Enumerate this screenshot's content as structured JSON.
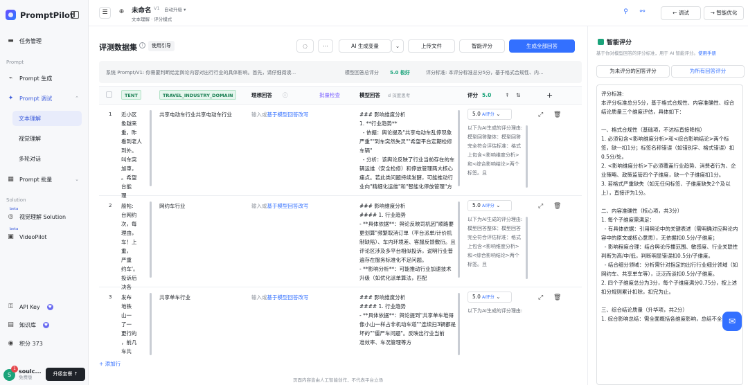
{
  "brand": {
    "name": "PromptPilot"
  },
  "sidebar": {
    "task_mgmt": "任务管理",
    "section_prompt": "Prompt",
    "prompt_gen": "Prompt 生成",
    "prompt_tune": "Prompt 调试",
    "sub_text": "文本理解",
    "sub_vision": "视觉理解",
    "sub_multi": "多轮对话",
    "prompt_batch": "Prompt 批量",
    "section_solution": "Solution",
    "beta1": "beta",
    "vision_solution": "视觉理解 Solution",
    "beta2": "beta",
    "videopilot": "VideoPilot",
    "api_key": "API Key",
    "knowledge": "知识库",
    "points": "积分 373",
    "user_initial": "S",
    "user_notif": "1",
    "user_name": "soulc...",
    "user_plan": "免费版",
    "upgrade": "升级套餐 ↑"
  },
  "topbar": {
    "title": "未命名",
    "version": "V1",
    "auto_upgrade": "自动升级 ▾",
    "breadcrumb": "文本理解 · 评分模式",
    "debug": "← 调试",
    "optimize": "→ 智能优化"
  },
  "dataset": {
    "title": "评测数据集",
    "guide": "使用引导",
    "ai_gen_var": "AI 生成变量",
    "upload": "上传文件",
    "smart_score": "智能评分",
    "gen_all": "生成全部回答"
  },
  "infobar": {
    "system_prompt": "系统 Prompt/V1: 你需要判断给定舆论内容对出行行业的具体影响。首先，请仔细阅读...",
    "avg_label": "模型回答总评分",
    "avg_value": "5.0 极好",
    "criteria": "评分标准: 本评分标准总分5分，基于格式合规性、内..."
  },
  "table": {
    "headers": {
      "content": "TENT",
      "domain": "TRAVEL_INDUSTRY_DOMAIN",
      "ideal": "理想回答",
      "batch_check": "批量检查",
      "model": "模型回答",
      "model_extra": "d  深度思考",
      "score": "评分",
      "score_val": "5.0"
    },
    "rows": [
      {
        "num": "1",
        "content": "近小区\n象越来\n重，昨\n看到老人\n到外。\n叫车突\n加車，\n。希望\n台能\n理",
        "domain": "共享电动车行业共享电动车行业",
        "ideal_ph": "输入或",
        "ideal_link": "基于模型回答改写",
        "model": "### 影响维度分析\n1. **行业趋势**\n  - 依据：舆论提及\"共享电动车乱停现象严重\"\"到车突然失灵\"\"希望平台定期检修车辆\"\n  - 分析：该舆论反映了行业当前存在的车辆运维（安全检修）和停放管理两大核心痛点。若此类问题持续发酵，可能推动行业向\"精细化运维\"和\"智能化停放管理\"方向升级（如强化",
        "score": "5.0",
        "ai": "AI评分",
        "reason": "以下为AI生成的评分理由:\n模型回答整体：模型回答完全符合评估标准：格式上包含<影响维度分析>和<综合影响结论>两个标签。且"
      },
      {
        "num": "2",
        "content": "般帖:\n台网约\n次，每\n理由，\n车！上\n重，\n严重\n约车'。\n投诉后\n决各",
        "domain": "网约车行业",
        "ideal_ph": "输入或",
        "ideal_link": "基于模型回答改写",
        "model": "### 影响维度分析\n#### 1. 行业趋势\n- **具体依据**：舆论反映司机因\"顺路要更划算\"频繁取消订单（平台派单/计价机制缺陷）、车内环境差、客服反馈敷衍。且评论区涉及多平台相似投诉，说明行业普遍存在服务标准化不足问题。\n- **影响分析**：可能推动行业加速技术升级（如优化派单算法，匹配",
        "score": "5.0",
        "ai": "AI评分",
        "reason": "以下为AI生成的评分理由:\n模型回答整体：模型回答完全符合评估标准：格式上包含<影响维度分析>和<综合影响结论>两个标签。且"
      },
      {
        "num": "3",
        "content": "发布\n地铁\n山一\n了一\n更行的\n，前几\n车共",
        "domain": "共享单车行业",
        "ideal_ph": "输入或",
        "ideal_link": "基于模型回答改写",
        "model": "### 影响维度分析\n#### 1. 行业趋势\n- **具体依据**：舆论提到\"共享单车堆得像小山一样占非机动车道\"\"连续扫3辆都是坏的\"\"僵尸车问题\"。反映出行业当前\n准效率、车况管理等方",
        "score": "5.0",
        "ai": "AI评分",
        "reason": "以下为AI生成的评分理由:"
      }
    ]
  },
  "add_row": "+ 添加行",
  "footer": "页面内容皆由人工智能创作，不代表平台立场",
  "panel": {
    "title": "智能评分",
    "desc": "基于你对模型回答的评分标准，用于 AI 智能评分。",
    "manual": "使用手册",
    "btn_unscored": "为未评分的回答评分",
    "btn_all": "为所有回答评分",
    "criteria": "评分标准:\n本评分标准总分5分，基于格式合规性、内容准确性、综合结论质量三个维度评估，具体如下：\n\n一、格式合规性（基础项，不达标直接降档）\n1. 必须包含<影响维度分析>和<综合影响结论>两个标签，缺一扣1分；标签名称错误（如错别字、格式错误）扣0.5分/处。\n2. <影响维度分析>下必须覆盖行业趋势、消费者行为、企业策略、政策监管四个子维度，缺一个子维度扣1分。\n3. 若格式严重缺失（如无任何标签、子维度缺失2个及以上），直接评为1分。\n\n二、内容准确性（核心项，共3分）\n1. 每个子维度需满足：\n  - 有具体依据：引用舆论中的关键表述（需明确对应舆论内容中的原文或核心意思），无依据扣0.5分/子维度；\n  - 影响程度合理：结合舆论传播范围、敏感度、行业关联性判断为高/中/低，判断明显错误扣0.5分/子维度。\n  - 结合细分领域：分析需针对指定的出行行业细分领域（如网约车、共享单车等），泛泛而谈扣0.5分/子维度。\n2. 四个子维度总分为3分，每个子维度满分0.75分，按上述扣分规则累计扣除，扣完为止。\n\n三、综合结论质量（升华项，共2分）\n1. 综合影响总结：需全面概括各维度影响，总结不全面扣"
  }
}
